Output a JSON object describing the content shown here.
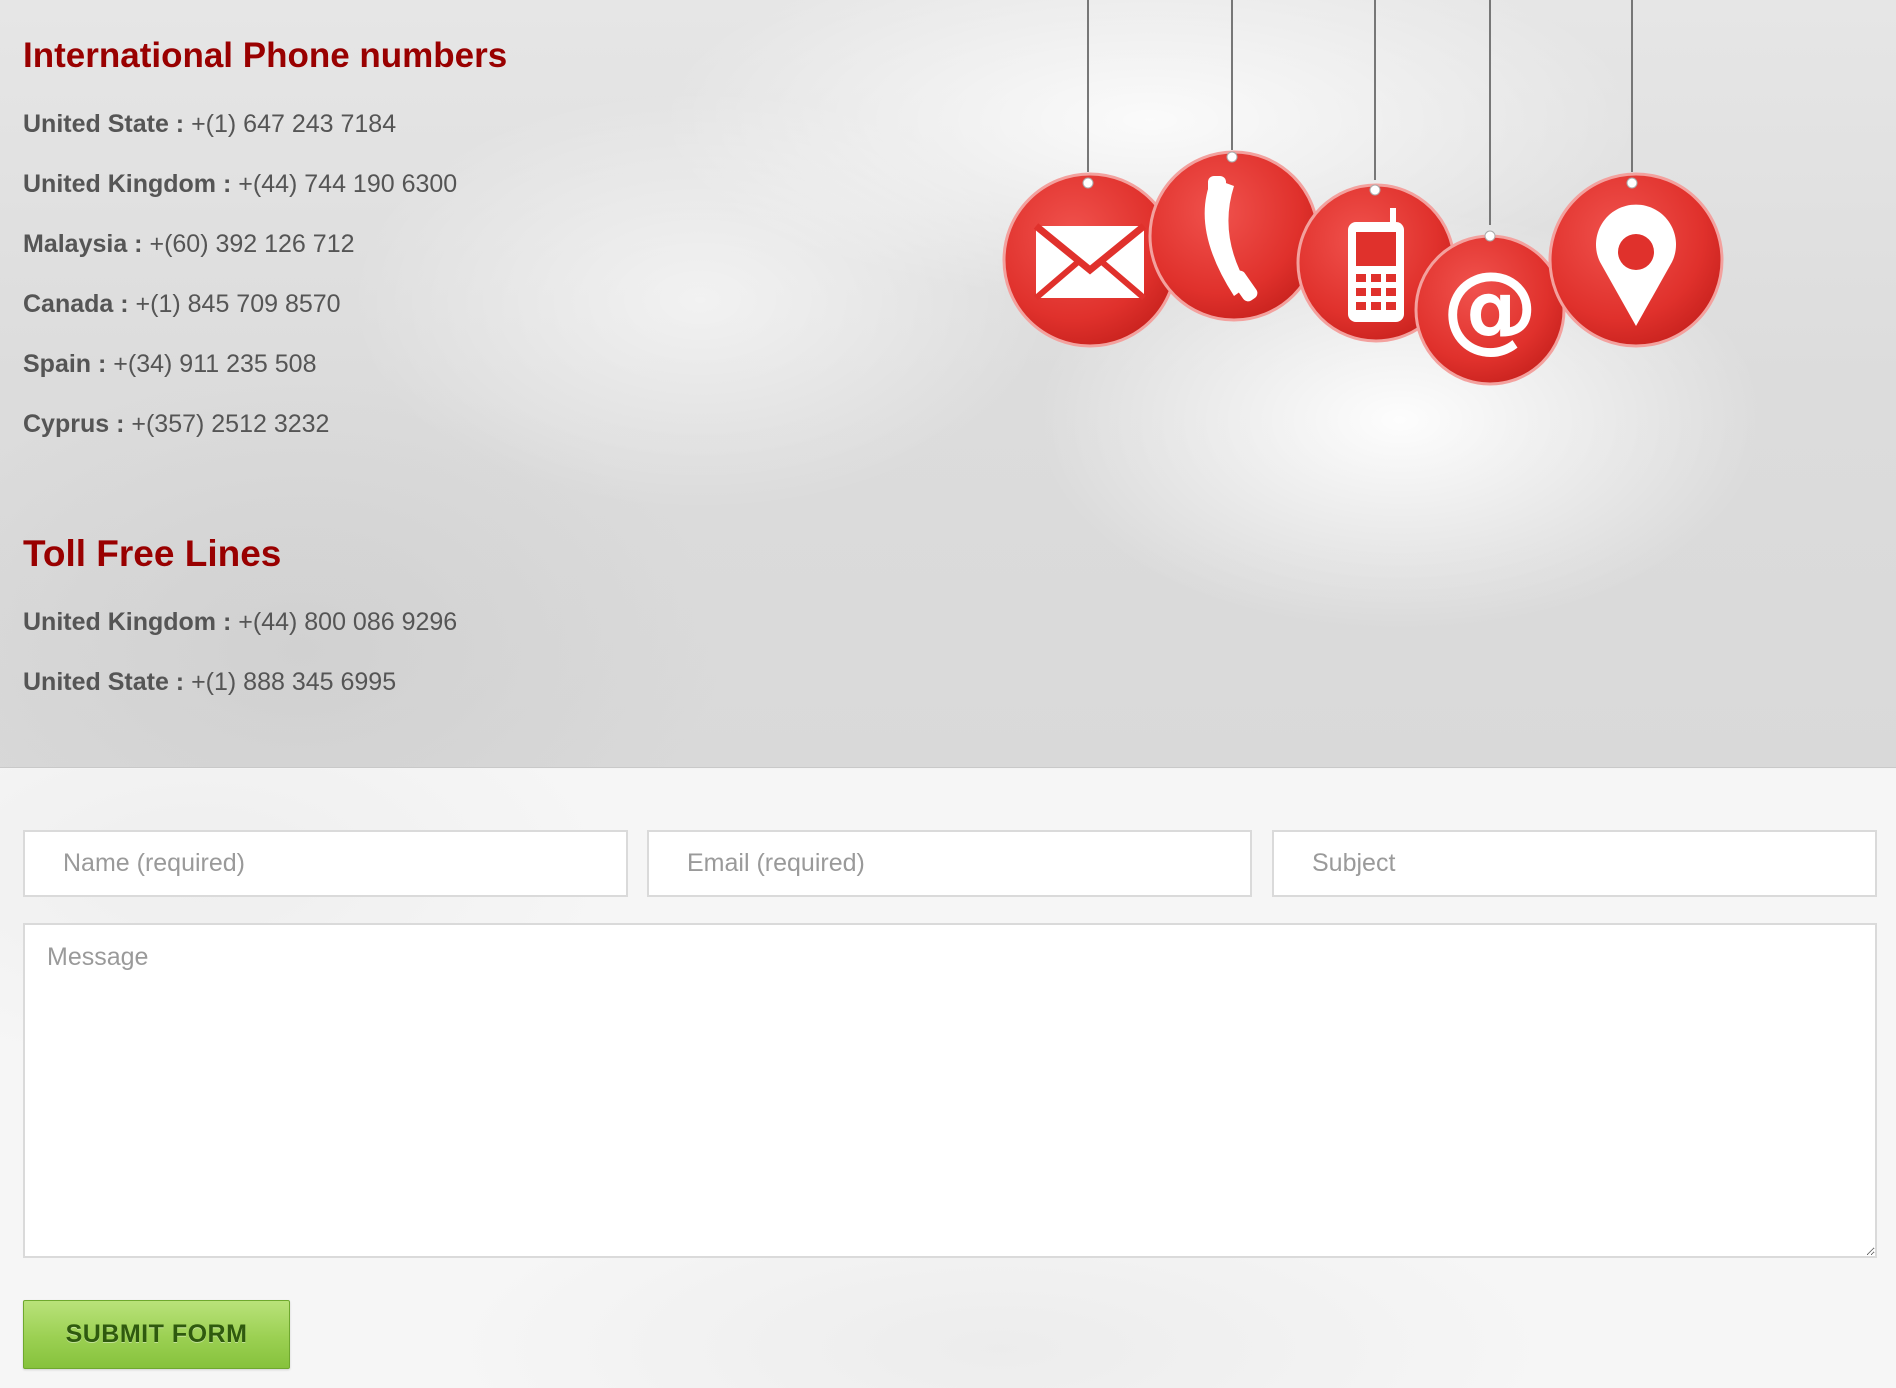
{
  "international": {
    "title": "International Phone numbers",
    "lines": [
      {
        "country": "United State :",
        "number": "+(1) 647 243 7184"
      },
      {
        "country": "United Kingdom :",
        "number": "+(44) 744 190 6300"
      },
      {
        "country": "Malaysia :",
        "number": "+(60) 392 126 712"
      },
      {
        "country": "Canada :",
        "number": "+(1) 845 709 8570"
      },
      {
        "country": "Spain :",
        "number": "+(34) 911 235 508"
      },
      {
        "country": "Cyprus :",
        "number": "+(357) 2512 3232"
      }
    ]
  },
  "toll_free": {
    "title": "Toll Free Lines",
    "lines": [
      {
        "country": "United Kingdom :",
        "number": "+(44) 800 086 9296"
      },
      {
        "country": "United State :",
        "number": "+(1) 888 345 6995"
      }
    ]
  },
  "hero_icons": [
    "envelope-icon",
    "phone-handset-icon",
    "mobile-phone-icon",
    "at-sign-icon",
    "location-pin-icon"
  ],
  "form": {
    "name_placeholder": "Name (required)",
    "email_placeholder": "Email (required)",
    "subject_placeholder": "Subject",
    "message_placeholder": "Message",
    "submit_label": "SUBMIT FORM"
  },
  "colors": {
    "heading": "#990000",
    "badge_red": "#e53935",
    "submit_green": "#9bd052"
  }
}
